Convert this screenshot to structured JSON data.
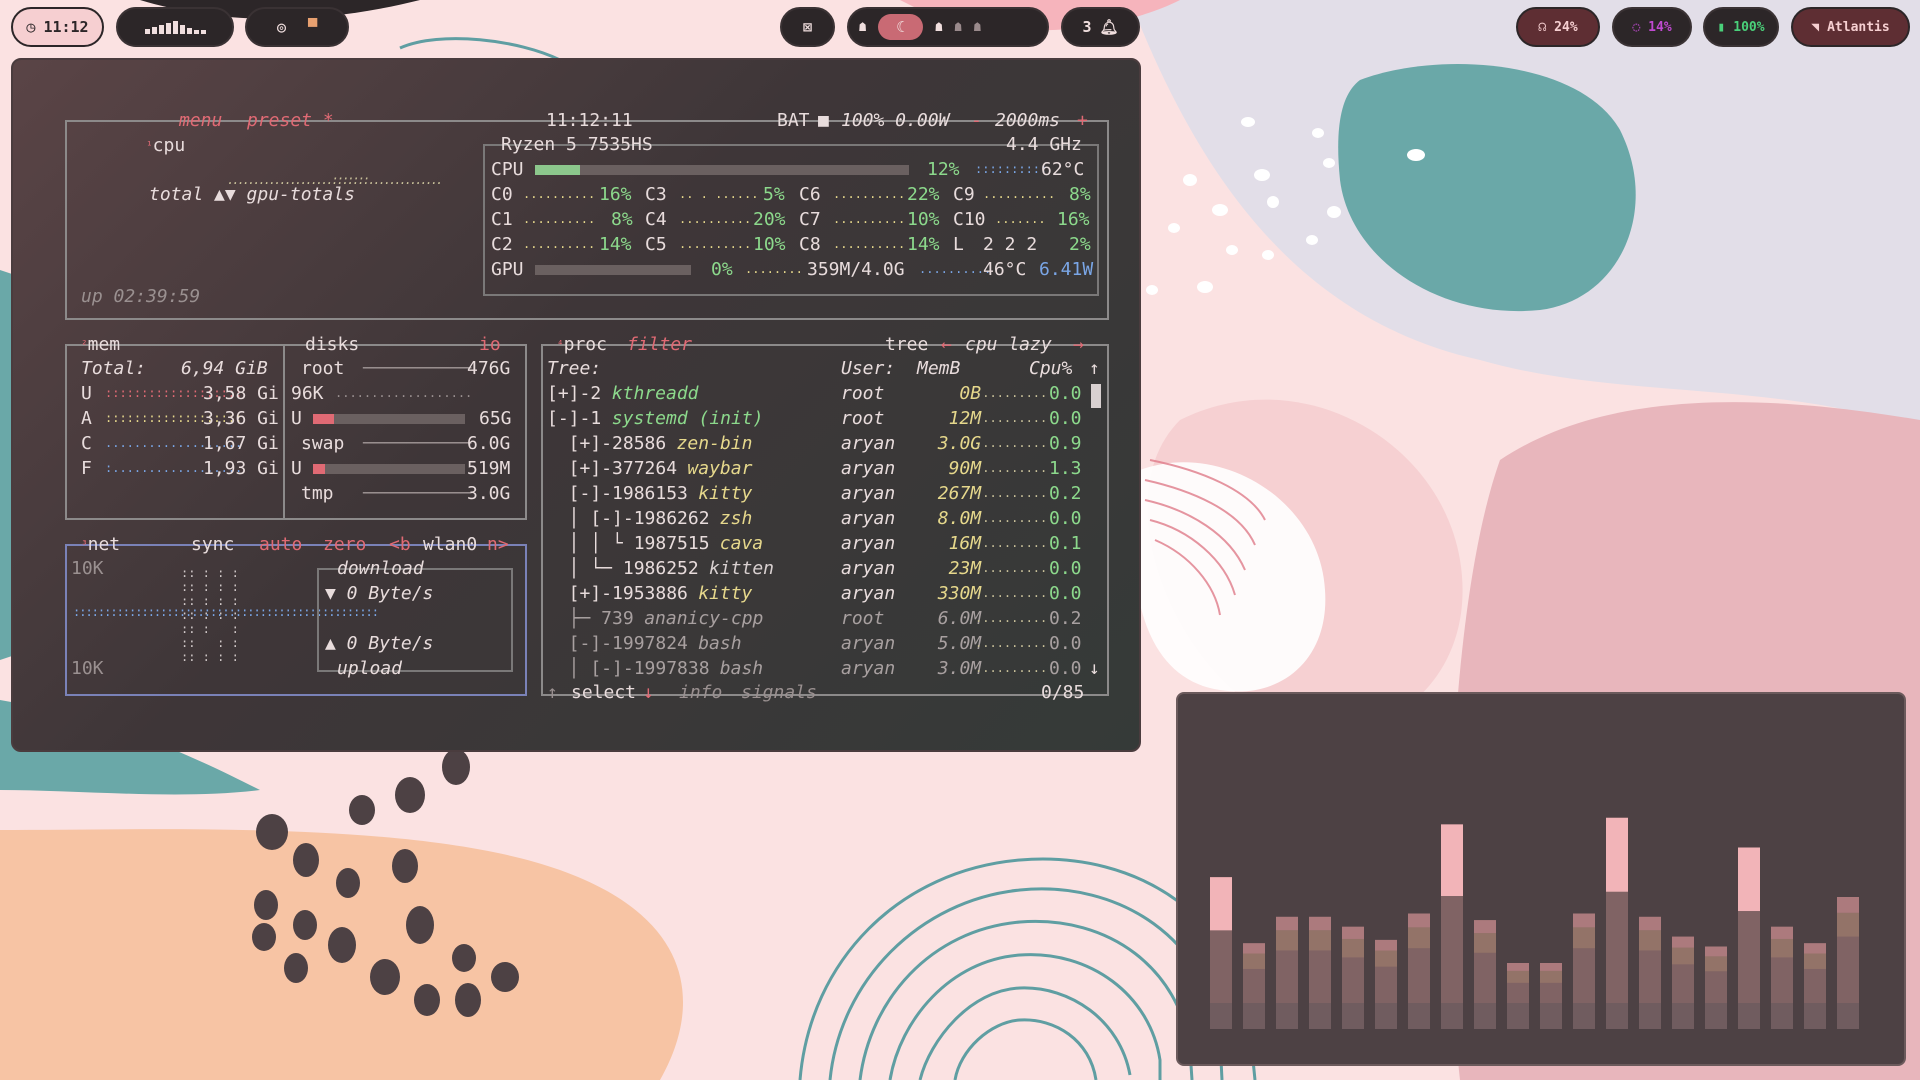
{
  "topbar": {
    "clock": "11:12",
    "workspace_count": "3",
    "headphone_volume": "24%",
    "cpu_load": "14%",
    "battery": "100%",
    "wifi_network": "Atlantis",
    "icons": [
      "clock-icon",
      "audio-bars-icon",
      "target-icon",
      "paint-roller-icon",
      "no-screen-icon",
      "ghost-icon",
      "moon-icon",
      "bell-icon",
      "headphones-icon",
      "spinner-icon",
      "battery-icon",
      "wifi-icon"
    ]
  },
  "btop": {
    "cpu_box": {
      "title": "cpu",
      "menu": "menu",
      "preset": "preset *",
      "time": "11:12:11",
      "battery": "BAT",
      "battery_value": "100% 0.00W",
      "interval": "2000ms",
      "model": "Ryzen 5 7535HS",
      "freq": "4.4 GHz",
      "total_label": "total ▲▼ gpu-totals",
      "uptime": "up 02:39:59",
      "cpu_label": "CPU",
      "cpu_pct": "12%",
      "cpu_temp": "62°C",
      "cores": [
        [
          "C0",
          "16%"
        ],
        [
          "C3",
          "5%"
        ],
        [
          "C6",
          "22%"
        ],
        [
          "C9",
          "8%"
        ],
        [
          "C1",
          "8%"
        ],
        [
          "C4",
          "20%"
        ],
        [
          "C7",
          "10%"
        ],
        [
          "C10",
          "16%"
        ],
        [
          "C2",
          "14%"
        ],
        [
          "C5",
          "10%"
        ],
        [
          "C8",
          "14%"
        ],
        [
          "L",
          "2 2 2",
          "2%"
        ]
      ],
      "gpu_label": "GPU",
      "gpu_pct": "0%",
      "gpu_mem": "359M/4.0G",
      "gpu_temp": "46°C",
      "gpu_power": "6.41W"
    },
    "mem_box": {
      "title": "mem",
      "disks_title": "disks",
      "io": "io",
      "total_label": "Total:",
      "total_value": "6,94 GiB",
      "rows": [
        [
          "U",
          "3,58 Gi"
        ],
        [
          "A",
          "3,36 Gi"
        ],
        [
          "C",
          "1,67 Gi"
        ],
        [
          "F",
          "1,93 Gi"
        ]
      ],
      "disks": {
        "root": "root",
        "root_size": "476G",
        "root_used": "96K",
        "root_u": "U",
        "root_u_val": "65G",
        "swap": "swap",
        "swap_size": "6.0G",
        "swap_u": "U",
        "swap_u_val": "519M",
        "tmp": "tmp",
        "tmp_size": "3.0G"
      }
    },
    "net_box": {
      "title": "net",
      "sync": "sync",
      "auto": "auto",
      "zero": "zero",
      "iface": "wlan0",
      "scale_top": "10K",
      "scale_bottom": "10K",
      "download": "download",
      "download_rate": "▼ 0 Byte/s",
      "upload": "upload",
      "upload_rate": "▲ 0 Byte/s"
    },
    "proc_box": {
      "title": "proc",
      "filter": "filter",
      "tree": "tree",
      "sort": "cpu lazy",
      "headers": [
        "Tree:",
        "User:",
        "MemB",
        "Cpu%"
      ],
      "rows": [
        {
          "tree": "[+]-2 ",
          "name": "kthreadd",
          "user": "root",
          "mem": "0B",
          "cpu": "0.0"
        },
        {
          "tree": "[-]-1 ",
          "name": "systemd (init)",
          "user": "root",
          "mem": "12M",
          "cpu": "0.0"
        },
        {
          "tree": "  [+]-28586 ",
          "name": "zen-bin",
          "user": "aryan",
          "mem": "3.0G",
          "cpu": "0.9"
        },
        {
          "tree": "  [+]-377264 ",
          "name": "waybar",
          "user": "aryan",
          "mem": "90M",
          "cpu": "1.3"
        },
        {
          "tree": "  [-]-1986153 ",
          "name": "kitty",
          "user": "aryan",
          "mem": "267M",
          "cpu": "0.2"
        },
        {
          "tree": "  │ [-]-1986262 ",
          "name": "zsh",
          "user": "aryan",
          "mem": "8.0M",
          "cpu": "0.0"
        },
        {
          "tree": "  │ │ └ 1987515 ",
          "name": "cava",
          "user": "aryan",
          "mem": "16M",
          "cpu": "0.1"
        },
        {
          "tree": "  │ └─ 1986252 ",
          "name": "kitten",
          "user": "aryan",
          "mem": "23M",
          "cpu": "0.0"
        },
        {
          "tree": "  [+]-1953886 ",
          "name": "kitty",
          "user": "aryan",
          "mem": "330M",
          "cpu": "0.0"
        },
        {
          "tree": "  ├─ 739 ",
          "name": "ananicy-cpp",
          "user": "root",
          "mem": "6.0M",
          "cpu": "0.2"
        },
        {
          "tree": "  [-]-1997824 ",
          "name": "bash",
          "user": "aryan",
          "mem": "5.0M",
          "cpu": "0.0"
        },
        {
          "tree": "  │ [-]-1997838 ",
          "name": "bash",
          "user": "aryan",
          "mem": "3.0M",
          "cpu": "0.0"
        }
      ],
      "footer_select": "select",
      "footer_info": "info",
      "footer_signals": "signals",
      "count": "0/85"
    }
  },
  "cava": {
    "bar_levels": [
      0.46,
      0.26,
      0.34,
      0.34,
      0.31,
      0.27,
      0.35,
      0.62,
      0.33,
      0.2,
      0.2,
      0.35,
      0.64,
      0.34,
      0.28,
      0.25,
      0.55,
      0.31,
      0.26,
      0.4
    ]
  },
  "colors": {
    "accent_red": "#e06a74",
    "accent_green": "#8cd98c",
    "bar_bg": "#2c2628",
    "pill_light": "#f6cfd1",
    "wall_teal": "#6aa8a8",
    "wall_peach": "#f7c4a4"
  }
}
